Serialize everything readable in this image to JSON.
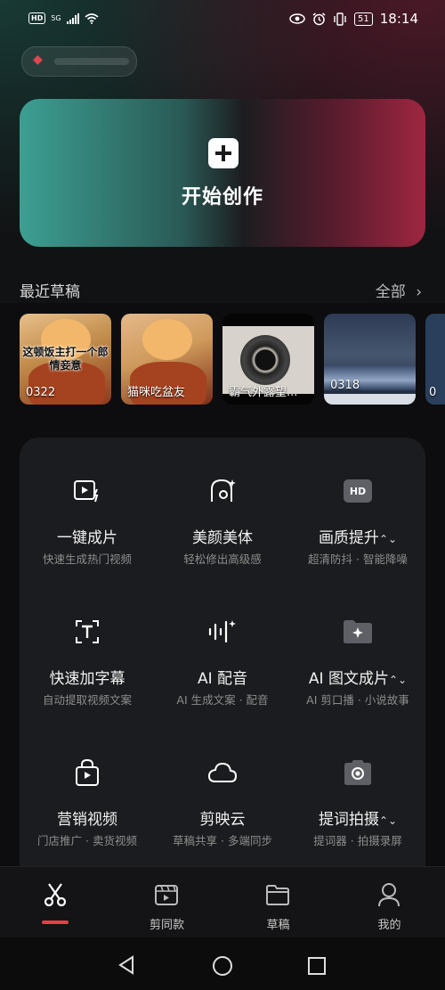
{
  "status_bar": {
    "network_badge": "HD",
    "signal_label": "5G",
    "battery": "51",
    "time": "18:14",
    "icons": [
      "eye-icon",
      "alarm-icon",
      "vibrate-icon",
      "battery-icon",
      "wifi-icon",
      "signal-icon"
    ]
  },
  "create": {
    "label": "开始创作"
  },
  "drafts": {
    "title": "最近草稿",
    "all_label": "全部",
    "items": [
      {
        "overlay": "这顿饭主打一个郎情妾意",
        "caption": "0322"
      },
      {
        "overlay": "",
        "caption": "猫咪吃盆友"
      },
      {
        "overlay": "",
        "caption": "霸气外露望..."
      },
      {
        "overlay": "",
        "caption": "0318"
      },
      {
        "overlay": "",
        "caption": "0"
      }
    ]
  },
  "tools": [
    {
      "name": "一键成片",
      "sub": "快速生成热门视频",
      "icon": "play-sparkle-icon"
    },
    {
      "name": "美颜美体",
      "sub": "轻松修出高级感",
      "icon": "face-beauty-icon"
    },
    {
      "name": "画质提升",
      "sub": "超清防抖 · 智能降噪",
      "icon": "hd-icon",
      "hd_text": "HD",
      "chevron": "⌃⌄"
    },
    {
      "name": "快速加字幕",
      "sub": "自动提取视频文案",
      "icon": "text-caption-icon"
    },
    {
      "name": "AI 配音",
      "sub": "AI 生成文案 · 配音",
      "icon": "voice-wave-icon"
    },
    {
      "name": "AI 图文成片",
      "sub": "AI 剪口播 · 小说故事",
      "icon": "folder-sparkle-icon",
      "chevron": "⌃⌄"
    },
    {
      "name": "营销视频",
      "sub": "门店推广 · 卖货视频",
      "icon": "shopping-bag-icon"
    },
    {
      "name": "剪映云",
      "sub": "草稿共享 · 多端同步",
      "icon": "cloud-icon"
    },
    {
      "name": "提词拍摄",
      "sub": "提词器 · 拍摄录屏",
      "icon": "camera-icon",
      "chevron": "⌃⌄"
    }
  ],
  "bottom_nav": [
    {
      "label": "",
      "icon": "scissors-icon",
      "active": true
    },
    {
      "label": "剪同款",
      "icon": "template-icon"
    },
    {
      "label": "草稿",
      "icon": "folder-icon"
    },
    {
      "label": "我的",
      "icon": "profile-icon"
    }
  ],
  "colors": {
    "accent": "#ee3b4b",
    "panel": "#1b1c1f",
    "teal": "#3c9f92",
    "crimson": "#9e2640"
  }
}
